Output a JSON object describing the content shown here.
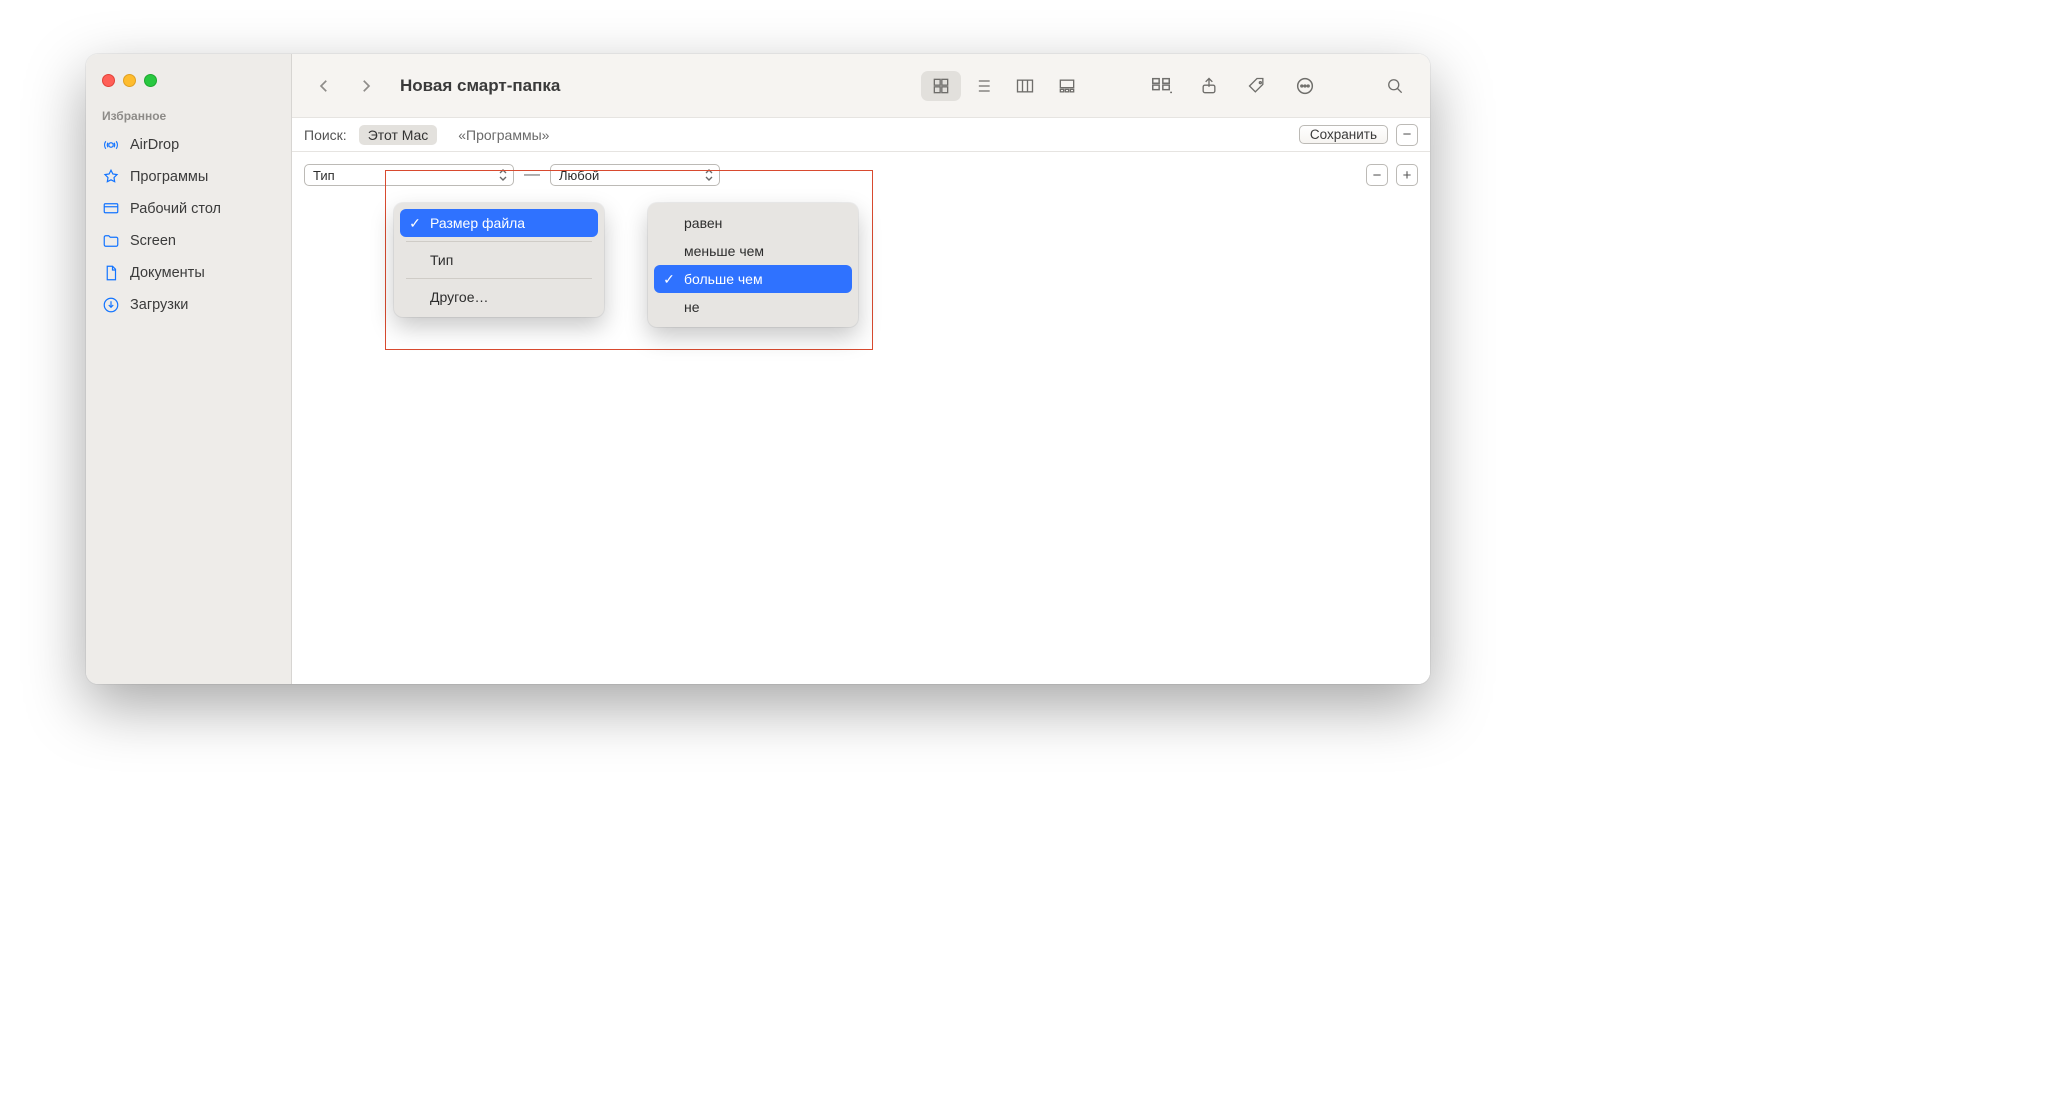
{
  "window": {
    "title": "Новая смарт-папка"
  },
  "sidebar": {
    "section": "Избранное",
    "items": [
      {
        "label": "AirDrop"
      },
      {
        "label": "Программы"
      },
      {
        "label": "Рабочий стол"
      },
      {
        "label": "Screen"
      },
      {
        "label": "Документы"
      },
      {
        "label": "Загрузки"
      }
    ]
  },
  "searchbar": {
    "label": "Поиск:",
    "scope_active": "Этот Mac",
    "scope_other": "«Программы»",
    "save": "Сохранить"
  },
  "rule": {
    "attribute_selected": "Тип",
    "separator": "—",
    "value_selected": "Любой"
  },
  "popup_attr": {
    "items": [
      {
        "label": "Размер файла",
        "selected": true
      },
      {
        "label": "Тип",
        "selected": false
      },
      {
        "label": "Другое…",
        "selected": false
      }
    ]
  },
  "popup_op": {
    "items": [
      {
        "label": "равен",
        "selected": false
      },
      {
        "label": "меньше чем",
        "selected": false
      },
      {
        "label": "больше чем",
        "selected": true
      },
      {
        "label": "не",
        "selected": false
      }
    ]
  },
  "glyphs": {
    "minus": "−",
    "plus": "+",
    "check": "✓"
  }
}
